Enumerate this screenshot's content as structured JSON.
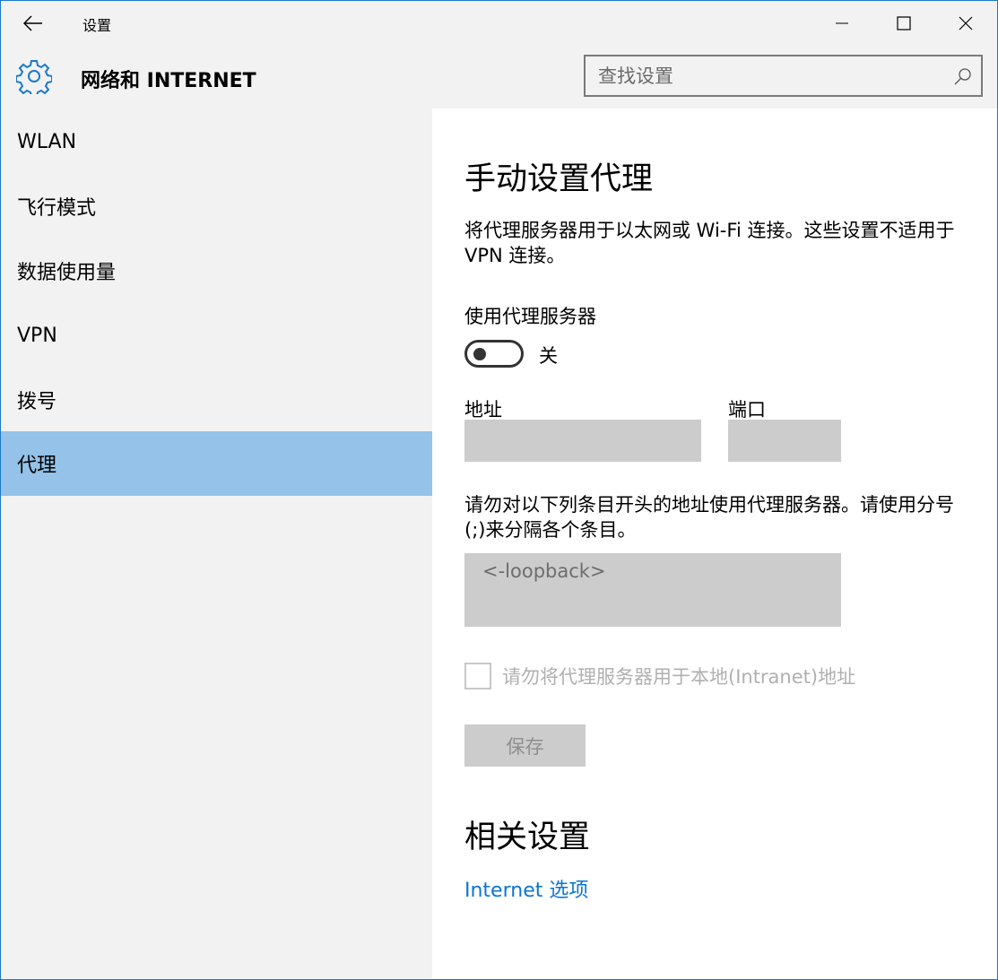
{
  "window": {
    "title": "设置"
  },
  "header": {
    "title": "网络和 INTERNET",
    "search_placeholder": "查找设置"
  },
  "sidebar": {
    "items": [
      {
        "label": "WLAN"
      },
      {
        "label": "飞行模式"
      },
      {
        "label": "数据使用量"
      },
      {
        "label": "VPN"
      },
      {
        "label": "拨号"
      },
      {
        "label": "代理"
      }
    ],
    "selected_index": 5
  },
  "content": {
    "heading": "手动设置代理",
    "description": "将代理服务器用于以太网或 Wi-Fi 连接。这些设置不适用于 VPN 连接。",
    "use_proxy_label": "使用代理服务器",
    "toggle_state": "关",
    "address_label": "地址",
    "address_value": "",
    "port_label": "端口",
    "port_value": "",
    "exceptions_description": "请勿对以下列条目开头的地址使用代理服务器。请使用分号(;)来分隔各个条目。",
    "exceptions_value": "<-loopback>",
    "bypass_local_label": "请勿将代理服务器用于本地(Intranet)地址",
    "save_label": "保存",
    "related_heading": "相关设置",
    "internet_options_link": "Internet 选项"
  },
  "colors": {
    "accent": "#0c75cf",
    "selected_nav": "#94c2e8",
    "sidebar_bg": "#f2f2f2",
    "disabled_field": "#cccccc"
  }
}
